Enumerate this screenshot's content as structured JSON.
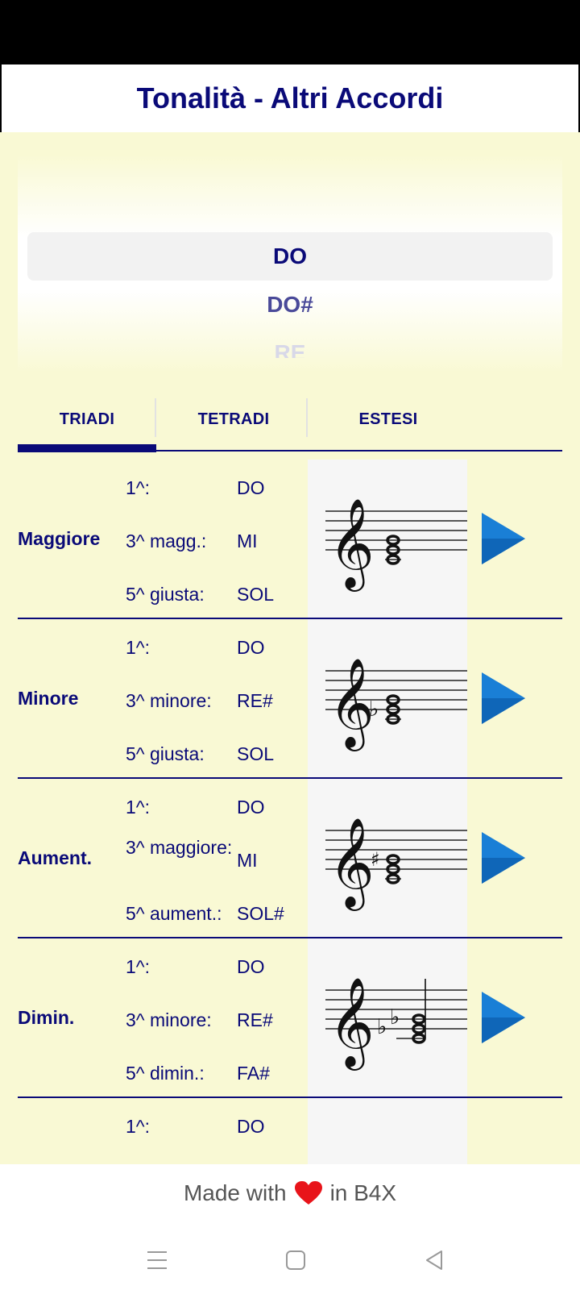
{
  "header": {
    "title": "Tonalità - Altri Accordi"
  },
  "picker": {
    "options": [
      "DO",
      "DO#",
      "RE"
    ],
    "selected": "DO"
  },
  "tabs": [
    {
      "label": "TRIADI",
      "active": true
    },
    {
      "label": "TETRADI",
      "active": false
    },
    {
      "label": "ESTESI",
      "active": false
    }
  ],
  "chords": [
    {
      "name": "Maggiore",
      "intervals": [
        "1^:",
        "3^ magg.:",
        "5^ giusta:"
      ],
      "notes": [
        "DO",
        "MI",
        "SOL"
      ],
      "accidentals": "none"
    },
    {
      "name": "Minore",
      "intervals": [
        "1^:",
        "3^ minore:",
        "5^ giusta:"
      ],
      "notes": [
        "DO",
        "RE#",
        "SOL"
      ],
      "accidentals": "flat-third"
    },
    {
      "name": "Aument.",
      "intervals": [
        "1^:",
        "3^ maggiore:",
        "5^ aument.:"
      ],
      "notes": [
        "DO",
        "MI",
        "SOL#"
      ],
      "accidentals": "sharp-fifth"
    },
    {
      "name": "Dimin.",
      "intervals": [
        "1^:",
        "3^ minore:",
        "5^ dimin.:"
      ],
      "notes": [
        "DO",
        "RE#",
        "FA#"
      ],
      "accidentals": "flat-third-fifth"
    }
  ],
  "partial_row": {
    "interval": "1^:",
    "note": "DO"
  },
  "footer": {
    "made_with": "Made with",
    "in_b4x": "in B4X"
  },
  "colors": {
    "accent": "#0a0a78",
    "background": "#f9f9d4",
    "play": "#1a7fd6",
    "heart": "#e8141a"
  },
  "icons": {
    "play": "play-icon",
    "heart": "heart-icon",
    "menu": "menu-icon",
    "home": "home-icon",
    "back": "back-icon"
  }
}
